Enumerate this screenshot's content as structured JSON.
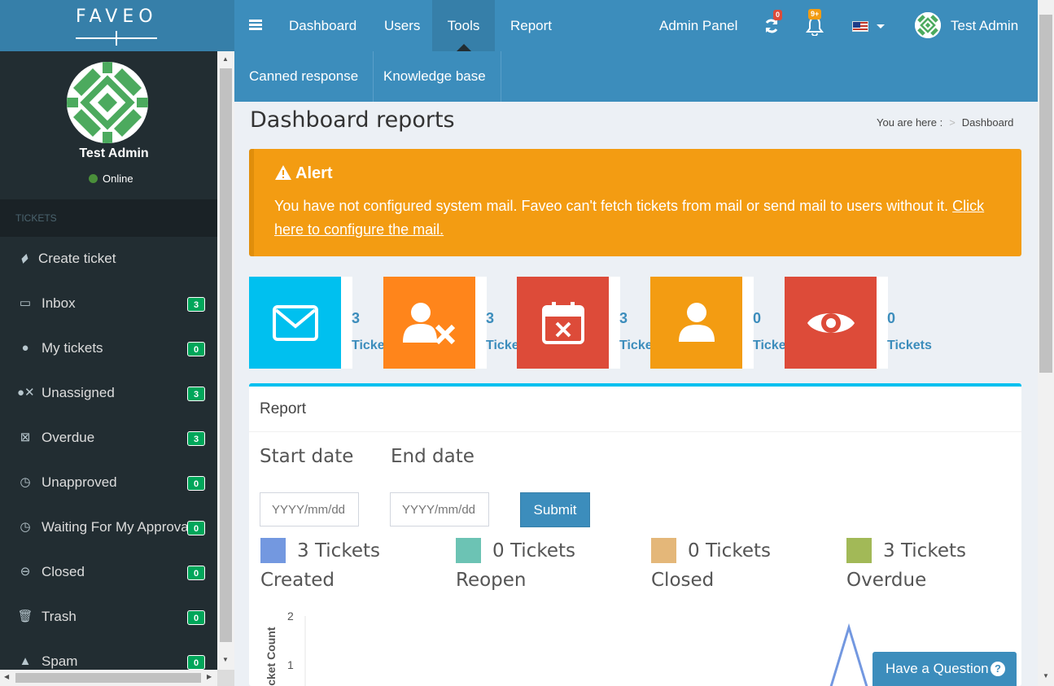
{
  "brand": {
    "logo_text": "FAVEO"
  },
  "topnav": {
    "items": [
      {
        "label": "Dashboard"
      },
      {
        "label": "Users"
      },
      {
        "label": "Tools"
      },
      {
        "label": "Report"
      }
    ],
    "active": "Tools",
    "admin_panel": "Admin Panel",
    "refresh_badge": "0",
    "notifications_badge": "9+",
    "user_name": "Test Admin"
  },
  "subnav": {
    "items": [
      {
        "label": "Canned response"
      },
      {
        "label": "Knowledge base"
      }
    ]
  },
  "sidebar": {
    "user_name": "Test Admin",
    "status": "Online",
    "section_header": "TICKETS",
    "items": [
      {
        "label": "Create ticket",
        "icon": "ticket-icon"
      },
      {
        "label": "Inbox",
        "count": "3",
        "icon": "inbox-icon"
      },
      {
        "label": "My tickets",
        "count": "0",
        "icon": "user-icon"
      },
      {
        "label": "Unassigned",
        "count": "3",
        "icon": "user-times-icon"
      },
      {
        "label": "Overdue",
        "count": "3",
        "icon": "calendar-times-icon"
      },
      {
        "label": "Unapproved",
        "count": "0",
        "icon": "clock-icon"
      },
      {
        "label": "Waiting For My Approval",
        "count": "0",
        "icon": "clock-icon"
      },
      {
        "label": "Closed",
        "count": "0",
        "icon": "minus-circle-icon"
      },
      {
        "label": "Trash",
        "count": "0",
        "icon": "trash-icon"
      },
      {
        "label": "Spam",
        "count": "0",
        "icon": "warning-icon"
      }
    ]
  },
  "page": {
    "title": "Dashboard reports",
    "breadcrumb_prefix": "You are here :",
    "breadcrumb_current": "Dashboard"
  },
  "alert": {
    "title": "Alert",
    "message": "You have not configured system mail. Faveo can't fetch tickets from mail or send mail to users without it.",
    "link_text": "Click here to configure the mail."
  },
  "info_boxes": [
    {
      "count": "3",
      "label": "Tickets",
      "color": "#00c0ef",
      "icon": "envelope-icon"
    },
    {
      "count": "3",
      "label": "Tickets",
      "color": "#ff851b",
      "icon": "user-times-icon"
    },
    {
      "count": "3",
      "label": "Tickets",
      "color": "#dd4b39",
      "icon": "calendar-times-icon"
    },
    {
      "count": "0",
      "label": "Tickets",
      "color": "#f39c12",
      "icon": "user-icon"
    },
    {
      "count": "0",
      "label": "Tickets",
      "color": "#dd4b39",
      "icon": "eye-icon"
    }
  ],
  "report": {
    "title": "Report",
    "start_date_label": "Start date",
    "end_date_label": "End date",
    "start_placeholder": "YYYY/mm/dd",
    "end_placeholder": "YYYY/mm/dd",
    "submit_label": "Submit",
    "legend": [
      {
        "value": "3 Tickets",
        "name": "Created",
        "color": "#7398e0"
      },
      {
        "value": "0 Tickets",
        "name": "Reopen",
        "color": "#6cc3b4"
      },
      {
        "value": "0 Tickets",
        "name": "Closed",
        "color": "#e4b779"
      },
      {
        "value": "3 Tickets",
        "name": "Overdue",
        "color": "#a2b957"
      }
    ]
  },
  "chart_data": {
    "type": "line",
    "ylabel": "Ticket Count",
    "yticks": [
      "2",
      "1"
    ],
    "ylim": [
      0,
      2
    ],
    "series": [
      {
        "name": "Created",
        "color": "#7398e0"
      }
    ]
  },
  "help_button": {
    "label": "Have a Question",
    "icon": "question-circle-icon"
  }
}
